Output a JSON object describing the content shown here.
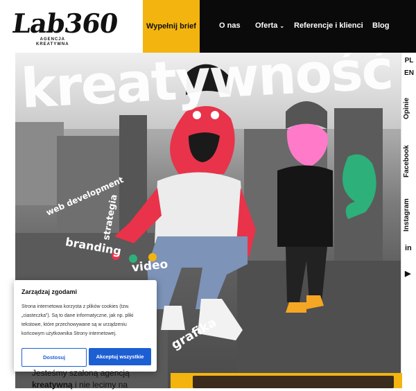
{
  "logo": {
    "text": "Lab360",
    "subtitle_line1": "AGENCJA",
    "subtitle_line2": "KREATYWNA"
  },
  "nav": {
    "brief": "Wypełnij brief",
    "items": [
      "O nas",
      "Oferta",
      "Referencje i klienci",
      "Blog"
    ]
  },
  "hero": {
    "headline": "kreatywność",
    "tags": [
      "web development",
      "strategia",
      "branding",
      "video",
      "grafika"
    ]
  },
  "side": {
    "lang_pl": "PL",
    "lang_en": "EN",
    "opinie": "Opinie",
    "facebook": "Facebook",
    "instagram": "Instagram",
    "linkedin_glyph": "in",
    "youtube_glyph": "▶"
  },
  "cookie": {
    "title": "Zarządzaj zgodami",
    "body": "Strona internetowa korzysta z plików cookies (tzw. „ciasteczka”). Są to dane informatyczne, jak np. pliki tekstowe, które przechowywane są w urządzeniu końcowym użytkownika Strony internetowej.",
    "reject": "Dostosuj",
    "accept": "Akceptuj wszystkie"
  },
  "intro": {
    "line1": "Jesteśmy szaloną agencją",
    "bold": "kreatywną",
    "rest": " i nie lecimy na"
  },
  "colors": {
    "accent": "#f3b40f",
    "nav_bg": "#0a0a0a",
    "button_blue": "#1d5fd3"
  }
}
